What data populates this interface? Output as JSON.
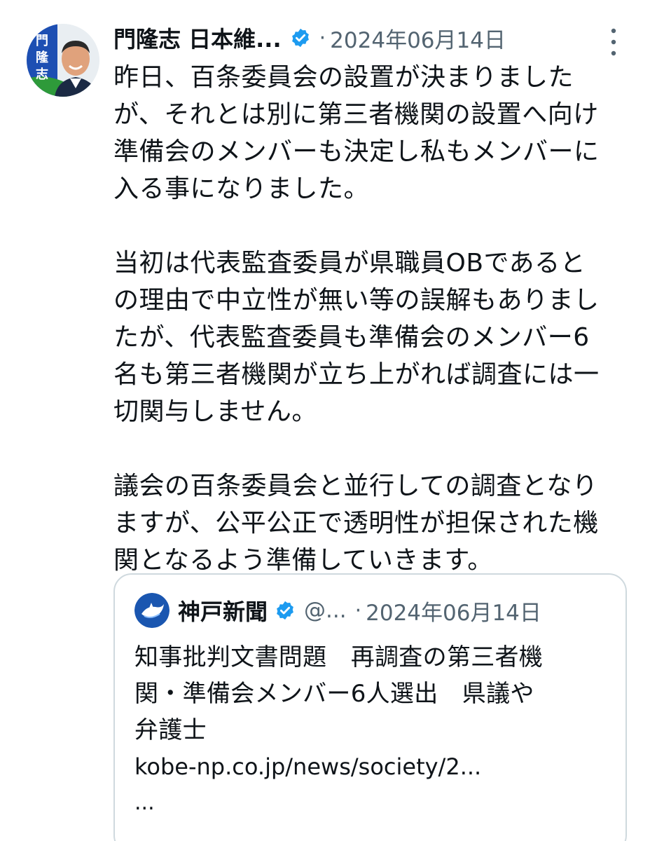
{
  "tweet": {
    "author_name": "門隆志 日本維...",
    "separator": "·",
    "date": "2024年06月14日",
    "avatar_text": "門隆志",
    "body_paragraphs": [
      [
        "昨日、百条委員会の設置が決まりました",
        "が、それとは別に第三者機関の設置へ向け",
        "準備会のメンバーも決定し私もメンバーに",
        "入る事になりました。"
      ],
      [
        "当初は代表監査委員が県職員OBであると",
        "の理由で中立性が無い等の誤解もありまし",
        "たが、代表監査委員も準備会のメンバー6",
        "名も第三者機関が立ち上がれば調査には一",
        "切関与しません。"
      ],
      [
        "議会の百条委員会と並行しての調査となり",
        "ますが、公平公正で透明性が担保された機",
        "関となるよう準備していきます。"
      ]
    ]
  },
  "quote": {
    "name": "神戸新聞",
    "handle": "@...",
    "separator": "·",
    "date": "2024年06月14日",
    "text_lines": [
      "知事批判文書問題　再調査の第三者機",
      "関・準備会メンバー6人選出　県議や",
      "弁護士"
    ],
    "link": "kobe-np.co.jp/news/society/2...",
    "ellipsis": "..."
  },
  "icons": {
    "verified": "verified-badge-icon",
    "more": "more-vertical-icon"
  },
  "colors": {
    "text": "#0f1419",
    "secondary": "#536471",
    "verified_blue": "#1d9bf0",
    "border": "#cfd9de"
  }
}
